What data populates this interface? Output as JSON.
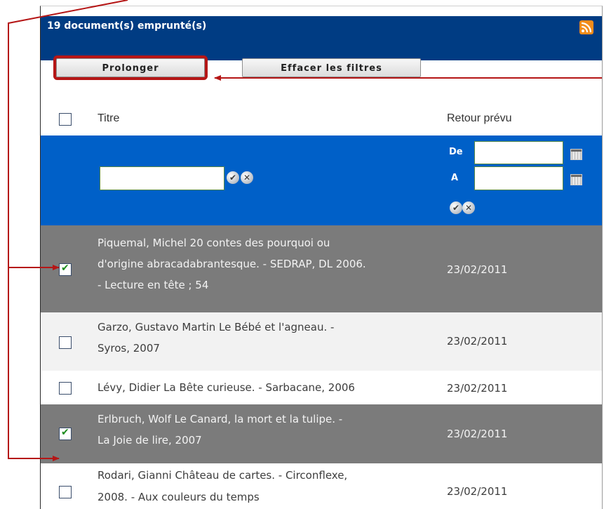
{
  "header": {
    "title": "19 document(s) emprunté(s)",
    "rss_icon": "rss-icon"
  },
  "toolbar": {
    "prolonger_label": "Prolonger",
    "effacer_label": "Effacer les filtres"
  },
  "columns": {
    "titre": "Titre",
    "retour": "Retour prévu"
  },
  "filters": {
    "title_value": "",
    "de_label": "De",
    "a_label": "A",
    "de_value": "",
    "a_value": ""
  },
  "rows": [
    {
      "checked": true,
      "lines": [
        "Piquemal, Michel 20 contes des pourquoi ou",
        "d'origine abracadabrantesque. - SEDRAP, DL 2006.",
        "- Lecture en tête ; 54"
      ],
      "date": "23/02/2011"
    },
    {
      "checked": false,
      "lines": [
        "Garzo, Gustavo Martin Le Bébé et l'agneau. -",
        "Syros, 2007"
      ],
      "date": "23/02/2011"
    },
    {
      "checked": false,
      "lines": [
        "Lévy, Didier La Bête curieuse. - Sarbacane, 2006"
      ],
      "date": "23/02/2011"
    },
    {
      "checked": true,
      "lines": [
        "Erlbruch, Wolf Le Canard, la mort et la tulipe. -",
        "La Joie de lire, 2007"
      ],
      "date": "23/02/2011"
    },
    {
      "checked": false,
      "lines": [
        "Rodari, Gianni Château de cartes. - Circonflexe,",
        "2008. - Aux couleurs du temps"
      ],
      "date": "23/02/2011"
    }
  ],
  "colors": {
    "header": "#003c83",
    "filter_bar": "#0060c8",
    "selected_row": "#7b7b7b",
    "alt_row": "#f2f2f2",
    "annotation": "#b51616",
    "checkmark": "#1e8d1e"
  }
}
